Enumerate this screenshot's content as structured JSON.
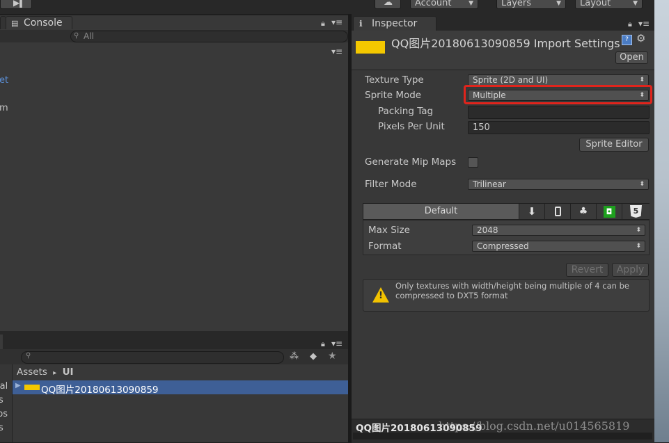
{
  "toolbar": {
    "account": "Account",
    "layers": "Layers",
    "layout": "Layout"
  },
  "left": {
    "console_tab": "Console",
    "search_placeholder": "All",
    "tree_fragments": [
      "et",
      "m"
    ],
    "side_fragments": [
      "ial",
      "s",
      "ps",
      "s"
    ],
    "breadcrumb": {
      "root": "Assets",
      "sep": "▸",
      "leaf": "UI"
    },
    "asset_item": "QQ图片20180613090859"
  },
  "inspector": {
    "tab": "Inspector",
    "title": "QQ图片20180613090859 Import Settings",
    "open_button": "Open",
    "texture_type_label": "Texture Type",
    "texture_type_value": "Sprite (2D and UI)",
    "sprite_mode_label": "Sprite Mode",
    "sprite_mode_value": "Multiple",
    "packing_tag_label": "Packing Tag",
    "packing_tag_value": "",
    "pixels_per_unit_label": "Pixels Per Unit",
    "pixels_per_unit_value": "150",
    "sprite_editor_button": "Sprite Editor",
    "generate_mip_maps_label": "Generate Mip Maps",
    "filter_mode_label": "Filter Mode",
    "filter_mode_value": "Trilinear",
    "platform_default": "Default",
    "max_size_label": "Max Size",
    "max_size_value": "2048",
    "format_label": "Format",
    "format_value": "Compressed",
    "revert_button": "Revert",
    "apply_button": "Apply",
    "warning_text": "Only textures with width/height being multiple of 4 can be compressed to DXT5 format",
    "preview_name": "QQ图片20180613090859",
    "watermark": "https://blog.csdn.net/u014565819"
  },
  "colors": {
    "highlight_red": "#e0241c",
    "selection_blue": "#3e5f96",
    "asset_yellow": "#f4c800"
  }
}
